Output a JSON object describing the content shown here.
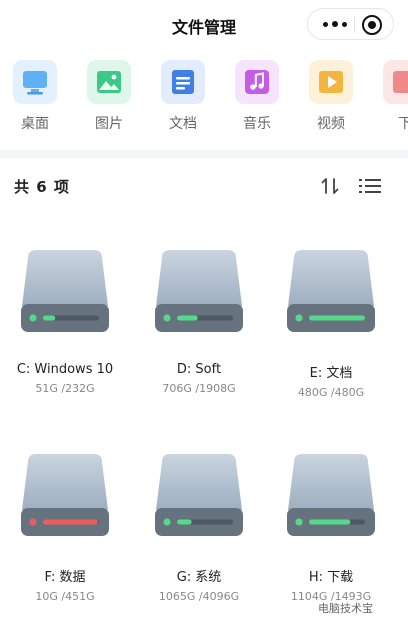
{
  "header": {
    "title": "文件管理"
  },
  "capsule": {
    "more_icon": "more-dots-icon",
    "close_icon": "target-circle-icon"
  },
  "categories": [
    {
      "label": "桌面",
      "icon": "desktop-icon",
      "color": "#5fb0f5",
      "bg": "#e3f0fd"
    },
    {
      "label": "图片",
      "icon": "image-icon",
      "color": "#3ac987",
      "bg": "#def7ea"
    },
    {
      "label": "文档",
      "icon": "document-icon",
      "color": "#3f7fe6",
      "bg": "#e2ecfc"
    },
    {
      "label": "音乐",
      "icon": "music-icon",
      "color": "#c65be8",
      "bg": "#f6e4fc"
    },
    {
      "label": "视频",
      "icon": "video-icon",
      "color": "#f2b53f",
      "bg": "#fdf1d9"
    },
    {
      "label": "下",
      "icon": "download-icon",
      "color": "#f08a8a",
      "bg": "#fde6e6"
    }
  ],
  "list": {
    "count_label": "共 6 项",
    "sort_icon": "sort-icon",
    "view_icon": "list-view-icon"
  },
  "drives": [
    {
      "name": "C: Windows 10",
      "usage": "51G /232G",
      "used_fraction": 0.22,
      "status_color": "#54d88a"
    },
    {
      "name": "D: Soft",
      "usage": "706G /1908G",
      "used_fraction": 0.37,
      "status_color": "#54d88a"
    },
    {
      "name": "E: 文档",
      "usage": "480G /480G",
      "used_fraction": 1.0,
      "status_color": "#54d88a"
    },
    {
      "name": "F: 数据",
      "usage": "10G /451G",
      "used_fraction": 0.98,
      "status_color": "#ef5b5b"
    },
    {
      "name": "G: 系统",
      "usage": "1065G /4096G",
      "used_fraction": 0.26,
      "status_color": "#54d88a"
    },
    {
      "name": "H: 下载",
      "usage": "1104G /1493G",
      "used_fraction": 0.74,
      "status_color": "#54d88a"
    }
  ],
  "watermark": "电脑技术宝"
}
